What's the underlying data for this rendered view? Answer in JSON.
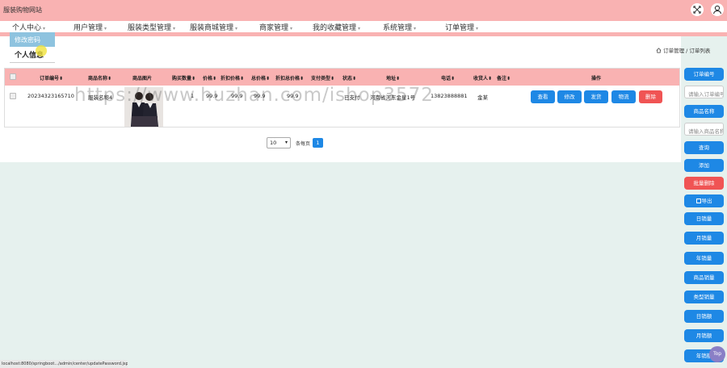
{
  "header": {
    "site_title": "服装购物网站",
    "fullscreen_icon": "fullscreen-icon",
    "user_icon": "user-icon"
  },
  "menu": [
    {
      "label": "个人中心"
    },
    {
      "label": "用户管理"
    },
    {
      "label": "服装类型管理"
    },
    {
      "label": "服装商城管理"
    },
    {
      "label": "商家管理"
    },
    {
      "label": "我的收藏管理"
    },
    {
      "label": "系统管理"
    },
    {
      "label": "订单管理"
    }
  ],
  "dropdown": {
    "items": [
      "修改密码",
      "个人信息"
    ]
  },
  "breadcrumb": {
    "home_icon": "home-icon",
    "path": "订单管理 / 订单列表"
  },
  "table": {
    "columns": [
      "订单编号",
      "商品名称",
      "商品图片",
      "购买数量",
      "价格",
      "折扣价格",
      "总价格",
      "折扣总价格",
      "支付类型",
      "状态",
      "地址",
      "电话",
      "收货人",
      "备注",
      "操作"
    ],
    "rows": [
      {
        "order_no": "20234323165710",
        "product_name": "服装名称4",
        "quantity": "1",
        "price": "99.9",
        "discount_price": "99.9",
        "total_price": "99.9",
        "discount_total": "99.9",
        "pay_type": "",
        "status": "已支付",
        "address": "河南省河东金星1号",
        "phone": "13823888881",
        "receiver": "金某",
        "remark": "",
        "actions": [
          "查看",
          "修改",
          "发货",
          "物流",
          "删除"
        ]
      }
    ]
  },
  "pagination": {
    "page_size": "10",
    "page_size_label": "条每页",
    "current_page": "1"
  },
  "sidebar": {
    "order_no_label": "订单编号",
    "order_no_placeholder": "请输入订单编号",
    "product_name_label": "商品名称",
    "product_name_placeholder": "请输入商品名称",
    "buttons": [
      "查询",
      "添加",
      "批量删除",
      "导出",
      "日销量",
      "月销量",
      "年销量",
      "商品销量",
      "类型销量",
      "日销额",
      "月销额",
      "年销额"
    ]
  },
  "watermark": "https://www.huzhan.com/ishop3572",
  "status_url": "localhost:8080/springboot.../admin/center/updatePassword.jsp",
  "top_button_label": "Top",
  "colors": {
    "header_pink": "#f9b2b2",
    "primary_blue": "#1e88e5",
    "danger_red": "#f05454",
    "page_background": "#e6f1ee"
  }
}
